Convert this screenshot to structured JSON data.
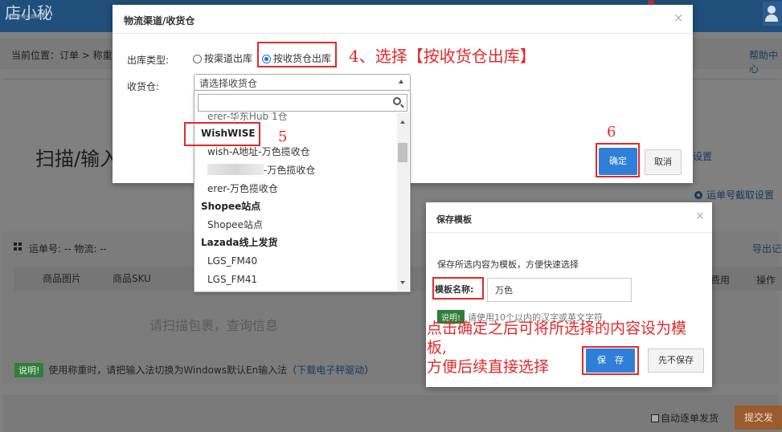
{
  "background": {
    "logo": "店小秘",
    "logo_sub": "免费跨境电商ERP",
    "breadcrumb": "当前位置：订单 > 称重",
    "help_link": "帮助中心",
    "scan_title": "扫描/输入",
    "print_setting": "设置",
    "waybill_setting": "运单号截取设置",
    "waybill_info": "运单号: -- 物流: --",
    "export_link": "导出记",
    "columns": {
      "image": "商品图片",
      "sku": "商品SKU",
      "fee": "费用",
      "op": "操作"
    },
    "empty_hint": "请扫描包裹，查询信息",
    "note_tag": "说明!",
    "note_text": "使用称重时，请把输入法切换为Windows默认En输入法（",
    "note_link": "下载电子秤驱动",
    "note_end": "）",
    "auto_ship": "自动逐单发货",
    "submit_ship": "提交发货"
  },
  "logistics_dialog": {
    "title": "物流渠道/收货仓",
    "close": "×",
    "outbound_label": "出库类型:",
    "radio_channel": "按渠道出库",
    "radio_warehouse": "按收货仓出库",
    "warehouse_label": "收货仓:",
    "select_placeholder": "请选择收货仓",
    "confirm": "确定",
    "cancel": "取消"
  },
  "dropdown": {
    "search_value": "",
    "options": {
      "partial": "erer-华东Hub 1仓",
      "wishwise": "WishWISE",
      "wish_a": "wish-A地址-万色揽收仓",
      "blurred_suffix": "-万色揽收仓",
      "erer": "erer-万色揽收仓",
      "shopee_group": "Shopee站点",
      "shopee": "Shopee站点",
      "lazada_group": "Lazada线上发货",
      "lgs40": "LGS_FM40",
      "lgs41": "LGS_FM41"
    }
  },
  "save_dialog": {
    "title": "保存模板",
    "close": "×",
    "desc": "保存所选内容为模板，方便快速选择",
    "name_label": "模板名称:",
    "name_value": "万色",
    "note_tag": "说明!",
    "note_text": "请使用10个以内的汉字或英文字符",
    "save": "保　存",
    "nosave": "先不保存"
  },
  "annotations": {
    "step4": "4、选择【按收货仓出库】",
    "step5": "5",
    "step6": "6",
    "long_line1": "点击确定之后可将所选择的内容设为模",
    "long_line2": "板,",
    "long_line3": "方便后续直接选择"
  },
  "colors": {
    "accent": "#2f7fd8",
    "annotation": "#e02a2a",
    "topbar": "#1f4f7a"
  }
}
